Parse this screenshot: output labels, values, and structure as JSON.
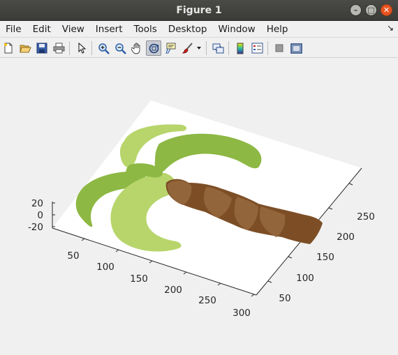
{
  "window": {
    "title": "Figure 1"
  },
  "menu": [
    "File",
    "Edit",
    "View",
    "Insert",
    "Tools",
    "Desktop",
    "Window",
    "Help"
  ],
  "toolbar": {
    "icons": [
      "new-figure-icon",
      "open-file-icon",
      "save-icon",
      "print-icon",
      "select-arrow-icon",
      "zoom-in-icon",
      "zoom-out-icon",
      "pan-hand-icon",
      "rotate-3d-icon",
      "data-cursor-icon",
      "brush-icon",
      "brush-dropdown-icon",
      "link-plot-icon",
      "colorbar-icon",
      "legend-icon",
      "hide-plot-tools-icon",
      "show-plot-tools-icon"
    ],
    "active": "rotate-3d-icon"
  },
  "axes": {
    "z_ticks": [
      "20",
      "0",
      "-20"
    ],
    "x_ticks": [
      "50",
      "100",
      "150",
      "200",
      "250",
      "300"
    ],
    "y_ticks": [
      "50",
      "100",
      "150",
      "200",
      "250"
    ]
  },
  "colors": {
    "leaf_light": "#b7d56b",
    "leaf_dark": "#8db844",
    "trunk": "#7d4e26",
    "trunk_light": "#93653b"
  }
}
